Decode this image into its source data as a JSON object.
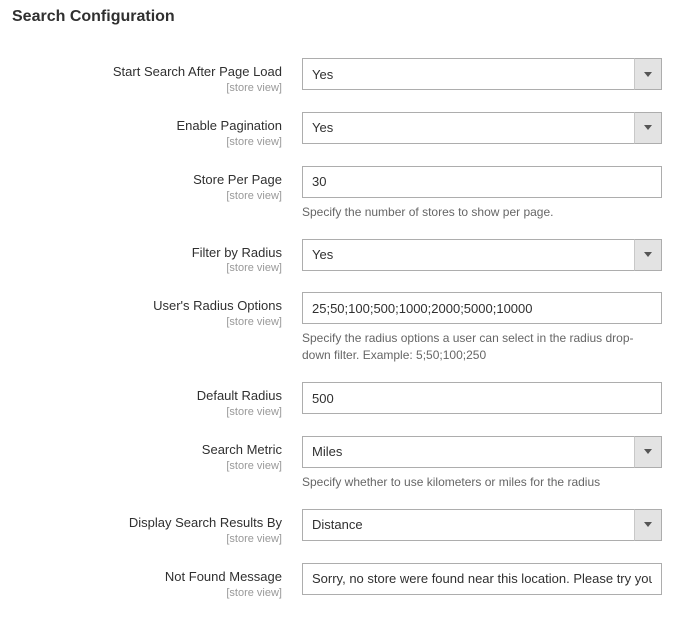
{
  "section_title": "Search Configuration",
  "scope_label": "[store view]",
  "fields": {
    "start_search": {
      "label": "Start Search After Page Load",
      "value": "Yes"
    },
    "enable_pagination": {
      "label": "Enable Pagination",
      "value": "Yes"
    },
    "store_per_page": {
      "label": "Store Per Page",
      "value": "30",
      "help": "Specify the number of stores to show per page."
    },
    "filter_by_radius": {
      "label": "Filter by Radius",
      "value": "Yes"
    },
    "users_radius_options": {
      "label": "User's Radius Options",
      "value": "25;50;100;500;1000;2000;5000;10000",
      "help": "Specify the radius options a user can select in the radius drop-down filter. Example: 5;50;100;250"
    },
    "default_radius": {
      "label": "Default Radius",
      "value": "500"
    },
    "search_metric": {
      "label": "Search Metric",
      "value": "Miles",
      "help": "Specify whether to use kilometers or miles for the radius"
    },
    "display_results_by": {
      "label": "Display Search Results By",
      "value": "Distance"
    },
    "not_found_message": {
      "label": "Not Found Message",
      "value": "Sorry, no store were found near this location. Please try your"
    }
  }
}
